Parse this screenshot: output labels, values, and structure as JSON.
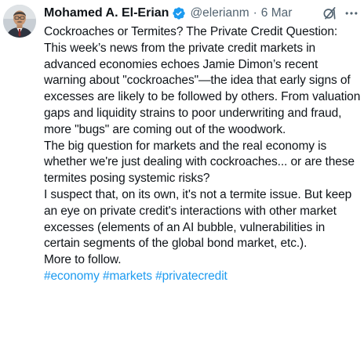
{
  "tweet": {
    "author": {
      "name": "Mohamed A. El-Erian",
      "handle": "@elerianm",
      "verified": true,
      "avatar_icon": "profile-photo"
    },
    "separator": "·",
    "date": "6 Mar",
    "icons": {
      "grok": "grok-icon",
      "more": "more-options-icon",
      "verified": "verified-badge-icon"
    },
    "paragraphs": [
      "Cockroaches or Termites? The Private Credit Question:",
      "This week’s news from the private credit markets in advanced economies echoes Jamie Dimon’s recent warning about \"cockroaches\"—the idea that early signs of excesses are likely to be followed by others. From valuation gaps and liquidity strains to poor underwriting and fraud, more \"bugs\" are coming out of the woodwork.",
      "The big question for markets and the real economy is whether we're just dealing with cockroaches... or are these termites posing systemic risks?",
      "I suspect that, on its own, it's not a termite issue. But keep an eye on private credit's interactions with other market excesses (elements of an AI bubble, vulnerabilities in certain segments of the global bond market, etc.).",
      "More to follow."
    ],
    "hashtags": [
      "#economy",
      "#markets",
      "#privatecredit"
    ]
  },
  "colors": {
    "text": "#0f1419",
    "secondary": "#536471",
    "link": "#1d9bf0",
    "verified": "#1d9bf0"
  }
}
